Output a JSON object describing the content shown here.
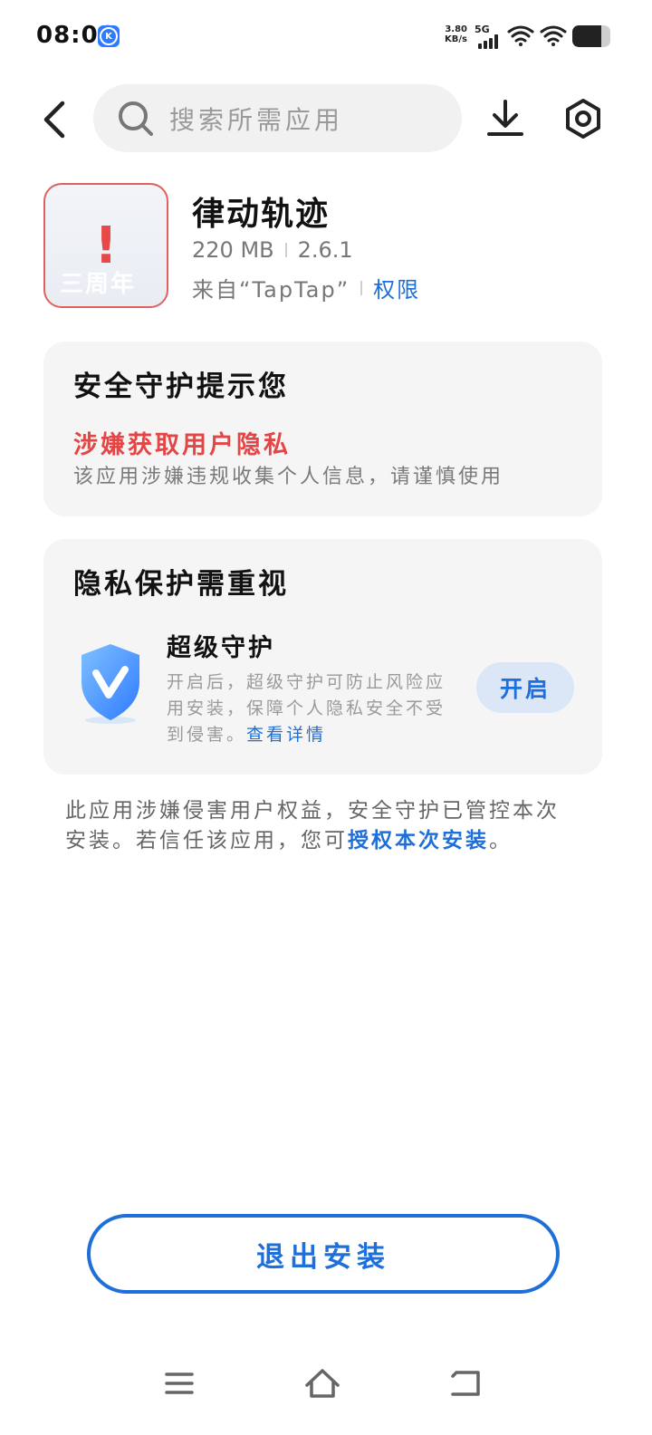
{
  "status_bar": {
    "time": "08:06",
    "app_icon_letter": "K",
    "net_speed_value": "3.80",
    "net_speed_unit": "KB/s",
    "network_type": "5G",
    "battery_level": 0.75
  },
  "header": {
    "search_placeholder": "搜索所需应用"
  },
  "app": {
    "name": "律动轨迹",
    "size": "220 MB",
    "version": "2.6.1",
    "source": "来自“TapTap”",
    "permission_label": "权限",
    "icon_watermark": "三周年"
  },
  "safety_card": {
    "title": "安全守护提示您",
    "warning_title": "涉嫌获取用户隐私",
    "warning_desc": "该应用涉嫌违规收集个人信息，请谨慎使用"
  },
  "privacy_card": {
    "title": "隐私保护需重视",
    "feature_title": "超级守护",
    "feature_desc": "开启后，超级守护可防止风险应用安装，保障个人隐私安全不受到侵害。",
    "detail_link": "查看详情",
    "enable_label": "开启"
  },
  "notice": {
    "text": "此应用涉嫌侵害用户权益，安全守护已管控本次安装。若信任该应用，您可",
    "authorize_link": "授权本次安装",
    "end": "。"
  },
  "exit_label": "退出安装",
  "colors": {
    "accent": "#1e6fd9",
    "danger": "#e64545",
    "card_bg": "#f5f5f5"
  }
}
